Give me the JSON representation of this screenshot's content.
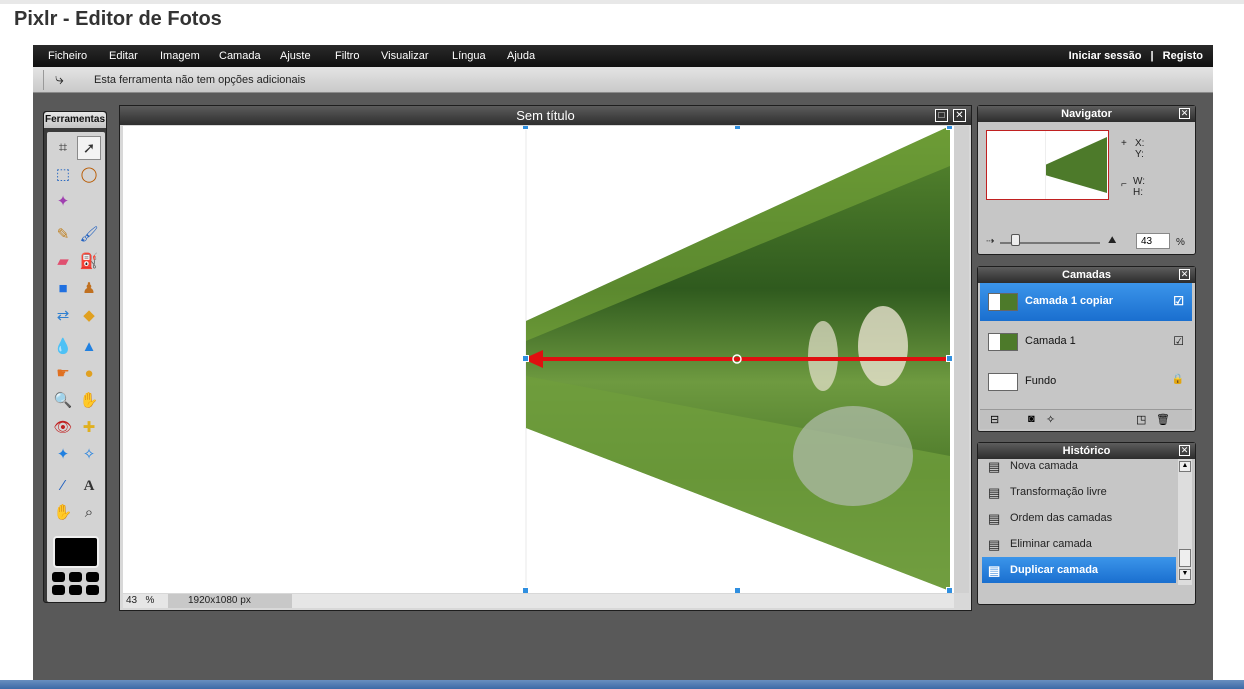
{
  "page": {
    "title": "Pixlr - Editor de Fotos"
  },
  "menu": {
    "items": [
      "Ficheiro",
      "Editar",
      "Imagem",
      "Camada",
      "Ajuste",
      "Filtro",
      "Visualizar",
      "Língua",
      "Ajuda"
    ],
    "login": "Iniciar sessão",
    "separator": "|",
    "register": "Registo"
  },
  "tool_options": {
    "text": "Esta ferramenta não tem opções adicionais"
  },
  "tools": {
    "title": "Ferramentas"
  },
  "canvas": {
    "title": "Sem título",
    "zoom": "43",
    "zoom_unit": "%",
    "dimensions": "1920x1080 px"
  },
  "navigator": {
    "title": "Navigator",
    "x_label": "X:",
    "y_label": "Y:",
    "w_label": "W:",
    "h_label": "H:",
    "zoom_value": "43",
    "zoom_unit": "%"
  },
  "layers": {
    "title": "Camadas",
    "items": [
      {
        "name": "Camada 1 copiar",
        "indicator": "☑"
      },
      {
        "name": "Camada 1",
        "indicator": "☑"
      },
      {
        "name": "Fundo",
        "indicator": "🔒"
      }
    ]
  },
  "history": {
    "title": "Histórico",
    "items": [
      "Nova camada",
      "Transformação livre",
      "Ordem das camadas",
      "Eliminar camada",
      "Duplicar camada"
    ]
  },
  "colors": {
    "accent": "#1a6fcf",
    "arrow": "#e01010"
  }
}
